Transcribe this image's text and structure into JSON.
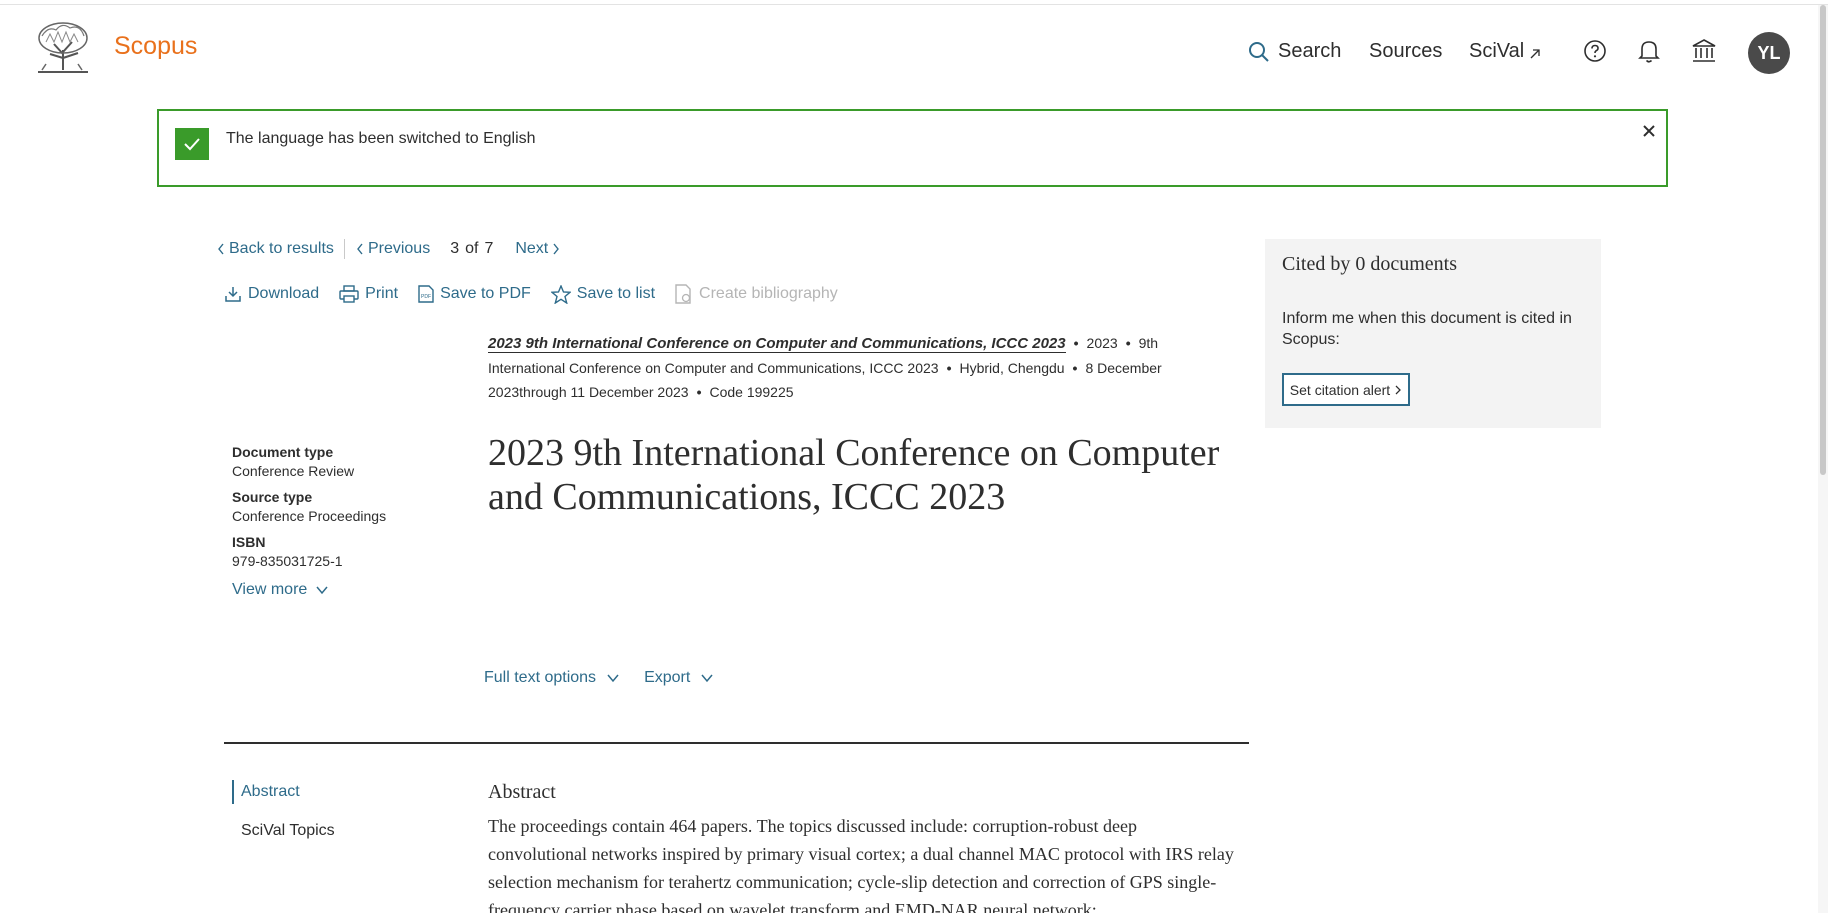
{
  "header": {
    "brand": "Scopus",
    "nav": {
      "search": "Search",
      "sources": "Sources",
      "scival": "SciVal"
    },
    "avatar_initials": "YL"
  },
  "banner": {
    "message": "The language has been switched to English"
  },
  "result_nav": {
    "back": "Back to results",
    "previous": "Previous",
    "current": "3",
    "of": "of",
    "total": "7",
    "next": "Next"
  },
  "toolbar": {
    "download": "Download",
    "print": "Print",
    "save_pdf": "Save to PDF",
    "save_list": "Save to list",
    "bibliography": "Create bibliography"
  },
  "citation": {
    "source_title": "2023 9th International Conference on Computer and Communications, ICCC 2023",
    "year": "2023",
    "conference": "9th International Conference on Computer and Communications, ICCC 2023",
    "location": "Hybrid, Chengdu",
    "dates": "8 December 2023through 11 December 2023",
    "code": "Code 199225"
  },
  "meta": {
    "doc_type_label": "Document type",
    "doc_type": "Conference Review",
    "source_type_label": "Source type",
    "source_type": "Conference Proceedings",
    "isbn_label": "ISBN",
    "isbn": "979-835031725-1",
    "view_more": "View more"
  },
  "document": {
    "title": "2023 9th International Conference on Computer and Communications, ICCC 2023"
  },
  "options": {
    "full_text": "Full text options",
    "export": "Export"
  },
  "side_nav": {
    "abstract": "Abstract",
    "scival_topics": "SciVal Topics"
  },
  "abstract": {
    "heading": "Abstract",
    "text": "The proceedings contain 464 papers. The topics discussed include: corruption-robust deep convolutional networks inspired by primary visual cortex; a dual channel MAC protocol with IRS relay selection mechanism for terahertz communication; cycle-slip detection and correction of GPS single-frequency carrier phase based on wavelet transform and EMD-NAR neural network;"
  },
  "cited_by": {
    "title": "Cited by 0 documents",
    "text": "Inform me when this document is cited in Scopus:",
    "alert_button": "Set citation alert"
  },
  "colors": {
    "brand": "#e9711c",
    "link": "#2e6b8a",
    "success": "#3a9b2a"
  }
}
